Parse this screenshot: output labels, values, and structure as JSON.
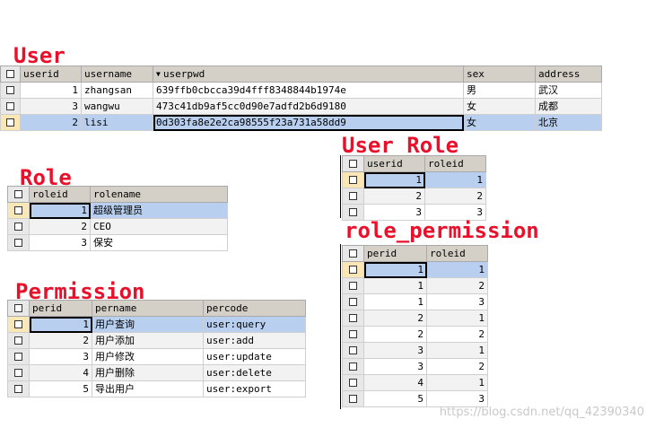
{
  "titles": {
    "user": "User",
    "user_role": "User_Role",
    "role": "Role",
    "role_permission": "role_permission",
    "permission": "Permission"
  },
  "user_table": {
    "headers": [
      "userid",
      "username",
      "userpwd",
      "sex",
      "address"
    ],
    "rows": [
      [
        "1",
        "zhangsan",
        "639ffb0cbcca39d4fff8348844b1974e",
        "男",
        "武汉"
      ],
      [
        "3",
        "wangwu",
        "473c41db9af5cc0d90e7adfd2b6d9180",
        "女",
        "成都"
      ],
      [
        "2",
        "lisi",
        "0d303fa8e2e2ca98555f23a731a58dd9",
        "女",
        "北京"
      ]
    ],
    "sort_icon": "sort-desc-icon"
  },
  "user_role_table": {
    "headers": [
      "userid",
      "roleid"
    ],
    "rows": [
      [
        "1",
        "1"
      ],
      [
        "2",
        "2"
      ],
      [
        "3",
        "3"
      ]
    ]
  },
  "role_table": {
    "headers": [
      "roleid",
      "rolename"
    ],
    "rows": [
      [
        "1",
        "超级管理员"
      ],
      [
        "2",
        "CEO"
      ],
      [
        "3",
        "保安"
      ]
    ]
  },
  "role_permission_table": {
    "headers": [
      "perid",
      "roleid"
    ],
    "rows": [
      [
        "1",
        "1"
      ],
      [
        "1",
        "2"
      ],
      [
        "1",
        "3"
      ],
      [
        "2",
        "1"
      ],
      [
        "2",
        "2"
      ],
      [
        "3",
        "1"
      ],
      [
        "3",
        "2"
      ],
      [
        "4",
        "1"
      ],
      [
        "5",
        "3"
      ]
    ]
  },
  "permission_table": {
    "headers": [
      "perid",
      "pername",
      "percode"
    ],
    "rows": [
      [
        "1",
        "用户查询",
        "user:query"
      ],
      [
        "2",
        "用户添加",
        "user:add"
      ],
      [
        "3",
        "用户修改",
        "user:update"
      ],
      [
        "4",
        "用户删除",
        "user:delete"
      ],
      [
        "5",
        "导出用户",
        "user:export"
      ]
    ]
  },
  "watermark": "https://blog.csdn.net/qq_42390340",
  "colors": {
    "title": "#e8102a",
    "selected_row": "#b8cff0",
    "selector_highlight": "#fae7b5",
    "header": "#d4d0c8"
  }
}
